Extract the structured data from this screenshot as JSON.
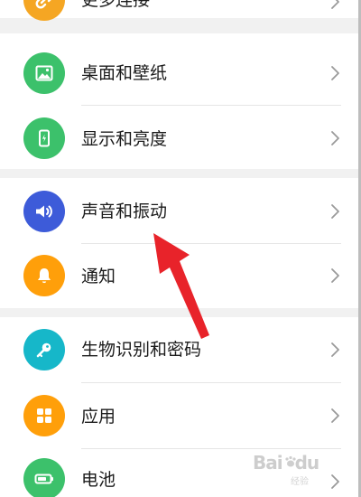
{
  "settings": {
    "items": [
      {
        "label": "更多连接",
        "icon": "link-icon",
        "color": "#f5a623"
      },
      {
        "label": "桌面和壁纸",
        "icon": "image-icon",
        "color": "#3cc16b"
      },
      {
        "label": "显示和亮度",
        "icon": "phone-brightness-icon",
        "color": "#3cc16b"
      },
      {
        "label": "声音和振动",
        "icon": "speaker-icon",
        "color": "#3d5bd9"
      },
      {
        "label": "通知",
        "icon": "bell-icon",
        "color": "#ff9f0a"
      },
      {
        "label": "生物识别和密码",
        "icon": "key-icon",
        "color": "#16b7c9"
      },
      {
        "label": "应用",
        "icon": "grid-icon",
        "color": "#ff9f0a"
      },
      {
        "label": "电池",
        "icon": "battery-icon",
        "color": "#3cc16b"
      }
    ]
  },
  "annotation": {
    "arrow_color": "#e8232a"
  },
  "watermark": {
    "text": "Bai",
    "logo": "du",
    "sub": "经验"
  }
}
